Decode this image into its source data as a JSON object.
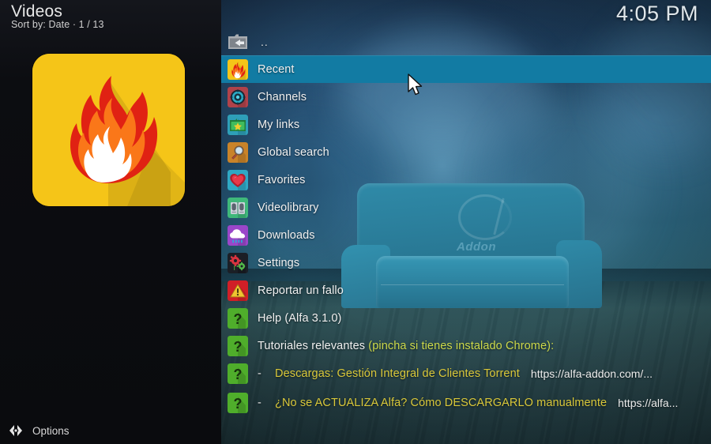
{
  "header": {
    "title": "Videos",
    "subtitle": "Sort by: Date  ·  1 / 13",
    "clock": "4:05 PM"
  },
  "sidebar": {
    "thumbnail_icon": "flame-icon",
    "thumbnail_bg_color": "#f5c518",
    "options_label": "Options",
    "options_icon": "left-right-arrows-icon"
  },
  "colors": {
    "highlight": "#127ba3",
    "sidebar_bg": "#0c0d11",
    "link_green": "#cdd94a",
    "link_yellow": "#d9c83a",
    "text": "#f0f0f0"
  },
  "menu": {
    "parent_row": {
      "label": "..",
      "icon": "folder-back-icon"
    },
    "items": [
      {
        "label": "Recent",
        "icon": "flame-icon",
        "selected": true,
        "url": ""
      },
      {
        "label": "Channels",
        "icon": "dial-icon",
        "selected": false,
        "url": ""
      },
      {
        "label": "My links",
        "icon": "folder-star-icon",
        "selected": false,
        "url": ""
      },
      {
        "label": "Global search",
        "icon": "magnifier-icon",
        "selected": false,
        "url": ""
      },
      {
        "label": "Favorites",
        "icon": "heart-icon",
        "selected": false,
        "url": ""
      },
      {
        "label": "Videolibrary",
        "icon": "books-icon",
        "selected": false,
        "url": ""
      },
      {
        "label": "Downloads",
        "icon": "cloud-rain-icon",
        "selected": false,
        "url": ""
      },
      {
        "label": "Settings",
        "icon": "gears-icon",
        "selected": false,
        "url": ""
      },
      {
        "label": "Reportar un fallo",
        "icon": "warning-icon",
        "selected": false,
        "url": ""
      },
      {
        "label": "Help (Alfa 3.1.0)",
        "icon": "question-icon",
        "selected": false,
        "url": ""
      }
    ],
    "tutorials_header": {
      "icon": "question-icon",
      "text_plain": "Tutoriales relevantes ",
      "text_colored": "(pincha si tienes instalado Chrome):"
    },
    "tutorials": [
      {
        "icon": "question-icon",
        "dash": "-",
        "label": "Descargas: Gestión Integral de Clientes Torrent",
        "url": "https://alfa-addon.com/..."
      },
      {
        "icon": "question-icon",
        "dash": "-",
        "label": "¿No se ACTUALIZA Alfa? Cómo DESCARGARLO manualmente",
        "url": "https://alfa..."
      }
    ]
  },
  "background": {
    "couch_word": "Addon"
  }
}
